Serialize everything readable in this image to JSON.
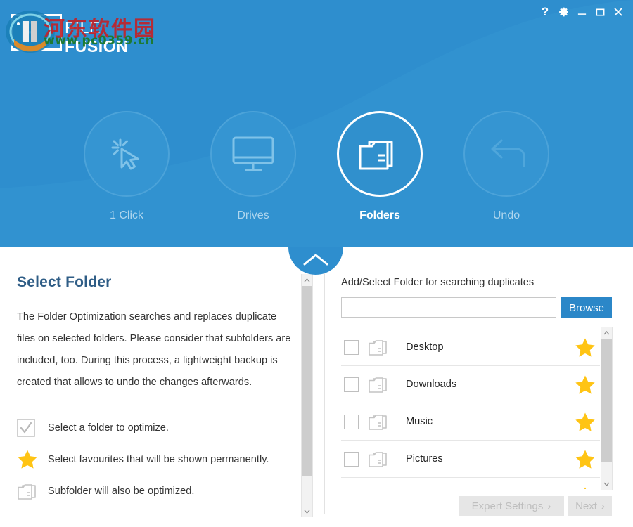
{
  "window": {
    "title": "File Fusion",
    "controls": [
      {
        "name": "help-button",
        "glyph": "?"
      },
      {
        "name": "settings-button",
        "glyph": "gear-icon"
      },
      {
        "name": "minimize-button",
        "glyph": "_"
      },
      {
        "name": "maximize-button",
        "glyph": "maximize-icon"
      },
      {
        "name": "close-button",
        "glyph": "close-icon"
      }
    ]
  },
  "brand": {
    "logo_letter": "F",
    "line1": "FILE",
    "line2": "FUSION"
  },
  "watermark": {
    "text_cn": "河东软件园",
    "url": "www.pc0359.cn"
  },
  "nav": {
    "items": [
      {
        "label": "1 Click",
        "icon": "cursor-click-icon",
        "active": false
      },
      {
        "label": "Drives",
        "icon": "monitor-icon",
        "active": false
      },
      {
        "label": "Folders",
        "icon": "folders-icon",
        "active": true
      },
      {
        "label": "Undo",
        "icon": "undo-arrow-icon",
        "active": false
      }
    ],
    "collapse_tab_icon": "chevron-up-icon"
  },
  "left_panel": {
    "title": "Select Folder",
    "description": "The Folder Optimization searches and replaces duplicate files on selected folders. Please consider that subfolders are included, too. During this process, a lightweight backup is created that allows to undo the changes afterwards.",
    "legend": [
      {
        "icon": "checkbox-checked-icon",
        "text": "Select a folder to optimize."
      },
      {
        "icon": "star-icon",
        "text": "Select favourites that will be shown permanently."
      },
      {
        "icon": "folder-icon",
        "text": "Subfolder will also be optimized."
      }
    ]
  },
  "right_panel": {
    "label": "Add/Select Folder for searching duplicates",
    "input_value": "",
    "input_placeholder": "",
    "browse_label": "Browse",
    "folders": [
      {
        "name": "Desktop",
        "checked": false,
        "favourite": true
      },
      {
        "name": "Downloads",
        "checked": false,
        "favourite": true
      },
      {
        "name": "Music",
        "checked": false,
        "favourite": true
      },
      {
        "name": "Pictures",
        "checked": false,
        "favourite": true
      },
      {
        "name": "",
        "checked": false,
        "favourite": true
      }
    ]
  },
  "footer": {
    "expert_settings_label": "Expert Settings",
    "expert_settings_chevron": "›",
    "next_label": "Next",
    "next_chevron": "›",
    "expert_settings_disabled": true,
    "next_disabled": true
  },
  "colors": {
    "header_blue": "#2E8ECE",
    "accent_blue": "#2B87C8",
    "title_blue": "#2F5D86",
    "star_yellow": "#FFC414",
    "disabled_gray": "#E6E6E6",
    "disabled_text": "#BEBEBE"
  }
}
